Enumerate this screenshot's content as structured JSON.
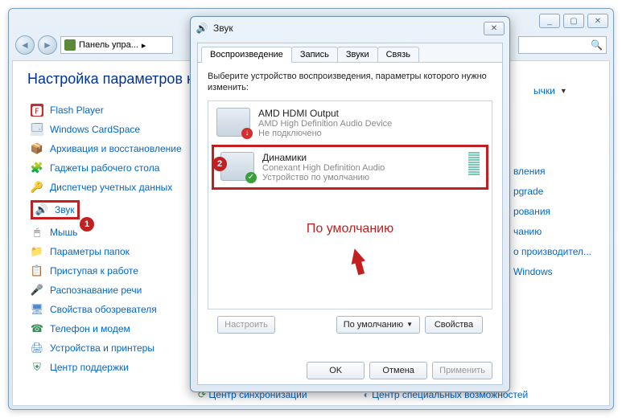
{
  "bg_window": {
    "addr_text": "Панель упра...",
    "min": "_",
    "max": "▢",
    "close": "✕",
    "truncated_link": "ычки",
    "title": "Настройка параметров ком",
    "items": [
      {
        "icon": "🅵",
        "label": "Flash Player",
        "ic_bg": "#c03030",
        "ic_fg": "#fff"
      },
      {
        "icon": "🗔",
        "label": "Windows CardSpace",
        "ic_bg": "#e0e8f0",
        "ic_fg": "#4a6a8a"
      },
      {
        "icon": "📦",
        "label": "Архивация и восстановление",
        "ic_bg": "transparent",
        "ic_fg": "#3a8a3a"
      },
      {
        "icon": "🧩",
        "label": "Гаджеты рабочего стола",
        "ic_bg": "transparent",
        "ic_fg": "#4a8acc"
      },
      {
        "icon": "🔑",
        "label": "Диспетчер учетных данных",
        "ic_bg": "transparent",
        "ic_fg": "#caa030"
      },
      {
        "icon": "🔊",
        "label": "Звук",
        "ic_bg": "transparent",
        "ic_fg": "#6a6a6a"
      },
      {
        "icon": "🖱",
        "label": "Мышь",
        "ic_bg": "transparent",
        "ic_fg": "#6a6a6a"
      },
      {
        "icon": "📁",
        "label": "Параметры папок",
        "ic_bg": "transparent",
        "ic_fg": "#d8b040"
      },
      {
        "icon": "📋",
        "label": "Приступая к работе",
        "ic_bg": "transparent",
        "ic_fg": "#6a8aab"
      },
      {
        "icon": "🎤",
        "label": "Распознавание речи",
        "ic_bg": "transparent",
        "ic_fg": "#3a8a5a"
      },
      {
        "icon": "🖥",
        "label": "Свойства обозревателя",
        "ic_bg": "transparent",
        "ic_fg": "#4a8acc"
      },
      {
        "icon": "☎",
        "label": "Телефон и модем",
        "ic_bg": "transparent",
        "ic_fg": "#3a8a5a"
      },
      {
        "icon": "🖨",
        "label": "Устройства и принтеры",
        "ic_bg": "transparent",
        "ic_fg": "#4a8acc"
      },
      {
        "icon": "⛨",
        "label": "Центр поддержки",
        "ic_bg": "transparent",
        "ic_fg": "#3a8a5a"
      }
    ],
    "right_items": [
      "вления",
      "pgrade",
      "рования",
      "чанию",
      "о производител...",
      "Windows"
    ],
    "bottom_items": [
      "Центр синхронизации",
      "Центр специальных возможностей"
    ]
  },
  "dialog": {
    "title": "Звук",
    "tabs": [
      "Воспроизведение",
      "Запись",
      "Звуки",
      "Связь"
    ],
    "instruction": "Выберите устройство воспроизведения, параметры которого нужно изменить:",
    "devices": [
      {
        "name": "AMD HDMI Output",
        "desc": "AMD High Definition Audio Device",
        "status": "Не подключено",
        "overlay": "red",
        "overlay_sym": "↓"
      },
      {
        "name": "Динамики",
        "desc": "Conexant High Definition Audio",
        "status": "Устройство по умолчанию",
        "overlay": "green",
        "overlay_sym": "✓"
      }
    ],
    "default_label": "По умолчанию",
    "btn_configure": "Настроить",
    "btn_default": "По умолчанию",
    "btn_props": "Свойства",
    "btn_ok": "OK",
    "btn_cancel": "Отмена",
    "btn_apply": "Применить"
  },
  "badges": {
    "one": "1",
    "two": "2"
  }
}
